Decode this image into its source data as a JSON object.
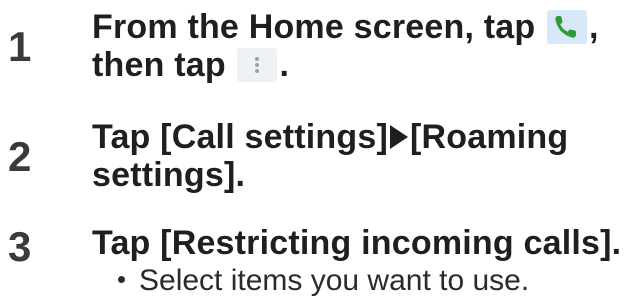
{
  "steps": [
    {
      "number": "1",
      "line1_prefix": "From the Home screen, tap ",
      "line1_suffix": ",",
      "line2_prefix": "then tap ",
      "line2_suffix": "."
    },
    {
      "number": "2",
      "line1_prefix": "Tap [Call settings]",
      "line1_suffix": "[Roaming",
      "line2": "settings]."
    },
    {
      "number": "3",
      "line1": "Tap [Restricting incoming calls].",
      "bullet": "Select items you want to use."
    }
  ],
  "icons": {
    "phone": "phone-icon",
    "menu": "more-menu-icon",
    "arrow": "right-triangle-arrow-icon"
  },
  "colors": {
    "text": "#1f1f1f",
    "phone_icon_bg": "#d7e9f8",
    "phone_icon_green": "#2e9b3a",
    "menu_icon_bg": "#eef2f4"
  }
}
